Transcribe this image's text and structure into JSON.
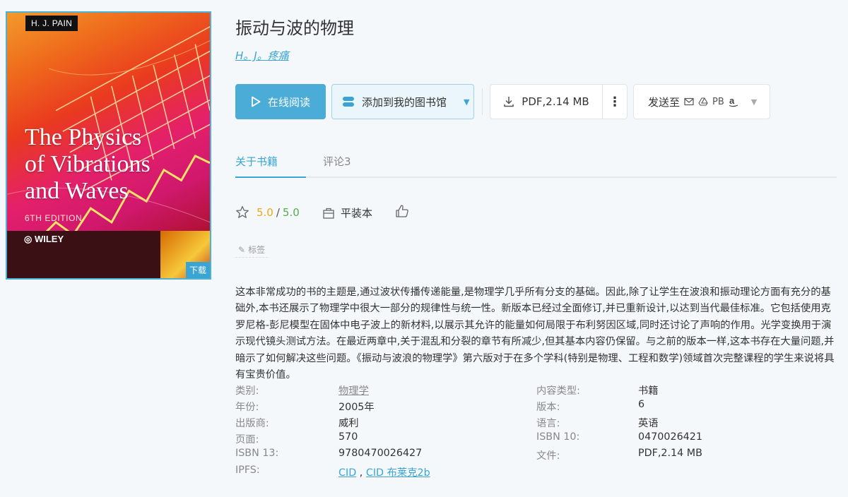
{
  "cover": {
    "author": "H. J. PAIN",
    "title_lines": [
      "The Physics",
      "of Vibrations",
      "and Waves"
    ],
    "edition": "6TH EDITION",
    "publisher": "WILEY",
    "download_label": "下载"
  },
  "book": {
    "title": "振动与波的物理",
    "author": "H。J。疼痛"
  },
  "actions": {
    "read_label": "在线阅读",
    "add_label": "添加到我的图书馆",
    "pdf_label": "PDF,2.14 MB",
    "more_label": "⋮",
    "send_label": "发送至",
    "send_pb": "PB"
  },
  "tabs": [
    {
      "label": "关于书籍",
      "active": true
    },
    {
      "label": "评论3",
      "active": false
    }
  ],
  "rating": {
    "value": "5.0",
    "separator": "/",
    "max": "5.0",
    "colors": {
      "value": "#e9a91a",
      "max": "#56ad4c"
    }
  },
  "format": "平装本",
  "tag_label": "标签",
  "description": "这本非常成功的书的主题是,通过波状传播传递能量,是物理学几乎所有分支的基础。因此,除了让学生在波浪和振动理论方面有充分的基础外,本书还展示了物理学中很大一部分的规律性与统一性。新版本已经过全面修订,并已重新设计,以达到当代最佳标准。它包括使用克罗尼格-彭尼模型在固体中电子波上的新材料,以展示其允许的能量如何局限于布利努因区域,同时还讨论了声响的作用。光学变换用于演示现代镜头测试方法。在最近两章中,关于混乱和分裂的章节有所减少,但其基本内容仍保留。与之前的版本一样,这本书存在大量问题,并暗示了如何解决这些问题。《振动与波浪的物理学》第六版对于在多个学科(特别是物理、工程和数学)领域首次完整课程的学生来说将具有宝贵价值。",
  "meta": {
    "category_key": "类别:",
    "category_val": "物理学",
    "year_key": "年份:",
    "year_val": "2005年",
    "publisher_key": "出版商:",
    "publisher_val": "威利",
    "pages_key": "页面:",
    "pages_val": "570",
    "isbn13_key": "ISBN 13:",
    "isbn13_val": "9780470026427",
    "ipfs_key": "IPFS:",
    "ipfs_cid": "CID",
    "ipfs_sep": ",",
    "ipfs_cid_blake": "CID 布莱克2b",
    "content_type_key": "内容类型:",
    "content_type_val": "书籍",
    "edition_key": "版本:",
    "edition_val": "6",
    "language_key": "语言:",
    "language_val": "英语",
    "isbn10_key": "ISBN 10:",
    "isbn10_val": "0470026421",
    "file_key": "文件:",
    "file_val": "PDF,2.14 MB"
  },
  "colors": {
    "accent": "#3aa5d3",
    "primary_button": "#4bacd7",
    "background": "#f4f8fa"
  },
  "icons": {
    "read": "play-icon",
    "add": "library-icon",
    "add_caret": "chevron-down-icon",
    "pdf": "download-icon",
    "more": "more-vertical-icon",
    "email": "mail-icon",
    "drive": "drive-icon",
    "amazon": "amazon-icon",
    "star": "star-icon",
    "format": "book-format-icon",
    "like": "thumbs-up-icon",
    "tag": "pencil-icon"
  }
}
